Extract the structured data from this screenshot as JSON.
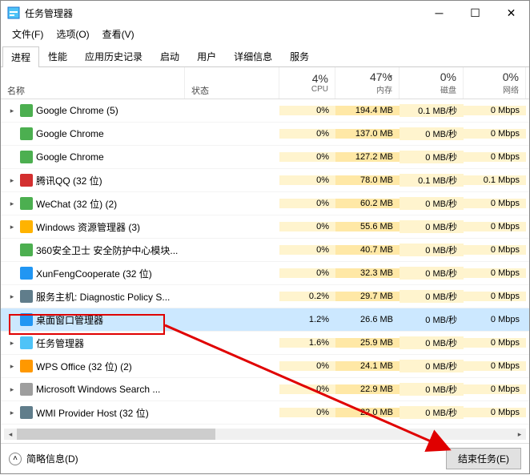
{
  "window": {
    "title": "任务管理器"
  },
  "menu": {
    "file": "文件(F)",
    "options": "选项(O)",
    "view": "查看(V)"
  },
  "tabs": [
    "进程",
    "性能",
    "应用历史记录",
    "启动",
    "用户",
    "详细信息",
    "服务"
  ],
  "columns": {
    "name": "名称",
    "status": "状态",
    "cpu": {
      "pct": "4%",
      "lbl": "CPU"
    },
    "mem": {
      "pct": "47%",
      "lbl": "内存"
    },
    "disk": {
      "pct": "0%",
      "lbl": "磁盘"
    },
    "net": {
      "pct": "0%",
      "lbl": "网络"
    }
  },
  "processes": [
    {
      "exp": "▸",
      "icon": "#4caf50",
      "name": "Google Chrome (5)",
      "cpu": "0%",
      "mem": "194.4 MB",
      "disk": "0.1 MB/秒",
      "net": "0 Mbps"
    },
    {
      "exp": "",
      "icon": "#4caf50",
      "name": "Google Chrome",
      "cpu": "0%",
      "mem": "137.0 MB",
      "disk": "0 MB/秒",
      "net": "0 Mbps"
    },
    {
      "exp": "",
      "icon": "#4caf50",
      "name": "Google Chrome",
      "cpu": "0%",
      "mem": "127.2 MB",
      "disk": "0 MB/秒",
      "net": "0 Mbps"
    },
    {
      "exp": "▸",
      "icon": "#d32f2f",
      "name": "腾讯QQ (32 位)",
      "cpu": "0%",
      "mem": "78.0 MB",
      "disk": "0.1 MB/秒",
      "net": "0.1 Mbps"
    },
    {
      "exp": "▸",
      "icon": "#4caf50",
      "name": "WeChat (32 位) (2)",
      "cpu": "0%",
      "mem": "60.2 MB",
      "disk": "0 MB/秒",
      "net": "0 Mbps"
    },
    {
      "exp": "▸",
      "icon": "#ffb300",
      "name": "Windows 资源管理器 (3)",
      "cpu": "0%",
      "mem": "55.6 MB",
      "disk": "0 MB/秒",
      "net": "0 Mbps"
    },
    {
      "exp": "",
      "icon": "#4caf50",
      "name": "360安全卫士 安全防护中心模块...",
      "cpu": "0%",
      "mem": "40.7 MB",
      "disk": "0 MB/秒",
      "net": "0 Mbps"
    },
    {
      "exp": "",
      "icon": "#2196f3",
      "name": "XunFengCooperate (32 位)",
      "cpu": "0%",
      "mem": "32.3 MB",
      "disk": "0 MB/秒",
      "net": "0 Mbps"
    },
    {
      "exp": "▸",
      "icon": "#607d8b",
      "name": "服务主机: Diagnostic Policy S...",
      "cpu": "0.2%",
      "mem": "29.7 MB",
      "disk": "0 MB/秒",
      "net": "0 Mbps"
    },
    {
      "exp": "",
      "icon": "#2196f3",
      "name": "桌面窗口管理器",
      "cpu": "1.2%",
      "mem": "26.6 MB",
      "disk": "0 MB/秒",
      "net": "0 Mbps",
      "selected": true
    },
    {
      "exp": "▸",
      "icon": "#4fc3f7",
      "name": "任务管理器",
      "cpu": "1.6%",
      "mem": "25.9 MB",
      "disk": "0 MB/秒",
      "net": "0 Mbps"
    },
    {
      "exp": "▸",
      "icon": "#ff9800",
      "name": "WPS Office (32 位) (2)",
      "cpu": "0%",
      "mem": "24.1 MB",
      "disk": "0 MB/秒",
      "net": "0 Mbps"
    },
    {
      "exp": "▸",
      "icon": "#9e9e9e",
      "name": "Microsoft Windows Search ...",
      "cpu": "0%",
      "mem": "22.9 MB",
      "disk": "0 MB/秒",
      "net": "0 Mbps"
    },
    {
      "exp": "▸",
      "icon": "#607d8b",
      "name": "WMI Provider Host (32 位)",
      "cpu": "0%",
      "mem": "22.0 MB",
      "disk": "0 MB/秒",
      "net": "0 Mbps"
    }
  ],
  "footer": {
    "fewer": "简略信息(D)",
    "end_task": "结束任务(E)"
  }
}
